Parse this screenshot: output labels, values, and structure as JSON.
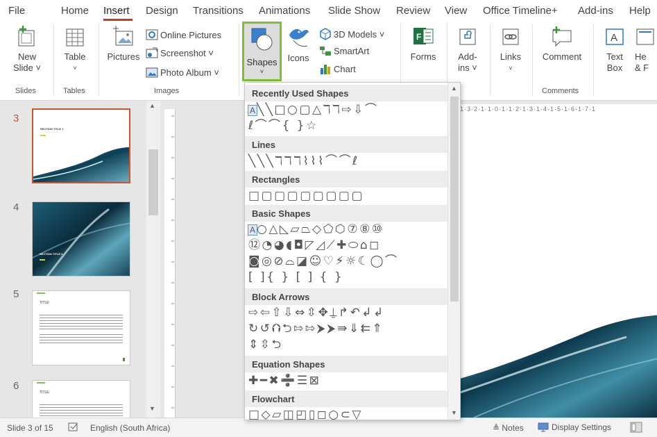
{
  "menu": {
    "tabs": [
      "File",
      "Home",
      "Insert",
      "Design",
      "Transitions",
      "Animations",
      "Slide Show",
      "Review",
      "View",
      "Office Timeline+",
      "Add-ins",
      "Help"
    ]
  },
  "ribbon": {
    "new_slide": [
      "New",
      "Slide ˅"
    ],
    "table": "Table",
    "pictures": "Pictures",
    "online_pictures": "Online Pictures",
    "screenshot": "Screenshot ˅",
    "photo_album": "Photo Album ˅",
    "shapes": "Shapes",
    "icons": "Icons",
    "models_3d": "3D Models ˅",
    "smartart": "SmartArt",
    "chart": "Chart",
    "forms": "Forms",
    "addins": [
      "Add-",
      "ins ˅"
    ],
    "links": "Links",
    "comment": "Comment",
    "textbox": [
      "Text",
      "Box"
    ],
    "header_footer": [
      "He",
      "& F"
    ],
    "groups": {
      "slides": "Slides",
      "tables": "Tables",
      "images": "Images",
      "comments": "Comments"
    }
  },
  "thumbnails": {
    "numbers": [
      "3",
      "4",
      "5",
      "6"
    ],
    "slide3_title": "SECTION TITLE 1",
    "slide4_title": "SECTION TITLE 2",
    "slide5_title": "TITLE",
    "slide6_title": "TITLE"
  },
  "ruler": {
    "h_text": "1·3·2·1·1·0·1·1·2·1·3·1·4·1·5·1·6·1·7·1"
  },
  "shapes_menu": {
    "sections": {
      "recent": "Recently Used Shapes",
      "lines": "Lines",
      "rectangles": "Rectangles",
      "basic": "Basic Shapes",
      "block_arrows": "Block Arrows",
      "equation": "Equation Shapes",
      "flowchart": "Flowchart"
    },
    "rows": {
      "recent_1": "╲╲□○▢△ℸℸ⇨⇩⌒",
      "recent_2": "ℓ⌒⌒{ }☆",
      "lines_1": "╲╲╲ℸℸℸ⌇⌇⌇⌒⌒ℓ",
      "rect_1": "□▢▢▢▢▢▢▢▢",
      "basic_1": "○△◺▱⏢◇⬠⬡⑦⑧⑩",
      "basic_2": "⑫◔◕◖◘◸◿⟋✚⬭⌂◻",
      "basic_3": "◙◎⊘⌓◪☺♡⚡☼☾◯⌒",
      "basic_4": "[ ]{ } [   ]   {   }",
      "arrows_1": "⇨⇦⇧⇩⇔⇳✥⍊↱↶↲↲",
      "arrows_2": "↻↺⮉⮌⇰⇰⮞⮞⇛⇓⇇⇑",
      "arrows_3": "⇕⇳⮌",
      "equation_1": "✚━✖➗☰⊠",
      "flowchart_1": "□◇▱◫◰▯◻○⊂▽"
    }
  },
  "status": {
    "slide_of": "Slide 3 of 15",
    "language": "English (South Africa)",
    "notes": "≜ Notes",
    "display": "Display Settings"
  },
  "colors": {
    "accent_green": "#7dc12c",
    "insert_underline": "#c43e1c",
    "selected_slide": "#c8552f"
  }
}
